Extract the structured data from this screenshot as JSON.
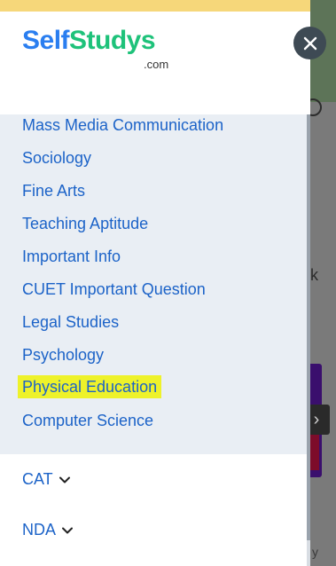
{
  "logo": {
    "self": "Self",
    "studys": "Studys",
    "com": ".com"
  },
  "subjects": [
    {
      "label": "Mass Media Communication"
    },
    {
      "label": "Sociology"
    },
    {
      "label": "Fine Arts"
    },
    {
      "label": "Teaching Aptitude"
    },
    {
      "label": "Important Info"
    },
    {
      "label": "CUET Important Question"
    },
    {
      "label": "Legal Studies"
    },
    {
      "label": "Psychology"
    },
    {
      "label": "Physical Education",
      "highlighted": true
    },
    {
      "label": "Computer Science"
    }
  ],
  "sections": [
    {
      "label": "CAT",
      "icon": "chevron-down-icon"
    },
    {
      "label": "NDA",
      "icon": "chevron-down-icon"
    }
  ],
  "close_icon": "close-icon",
  "background": {
    "partial_letter_1": "k",
    "partial_letter_2": "y",
    "arrow": "›"
  },
  "colors": {
    "link": "#1c63c8",
    "highlight": "#eef22a",
    "panel": "#e9eef4",
    "logo_blue": "#2a7ef0",
    "logo_green": "#1ec27a"
  }
}
